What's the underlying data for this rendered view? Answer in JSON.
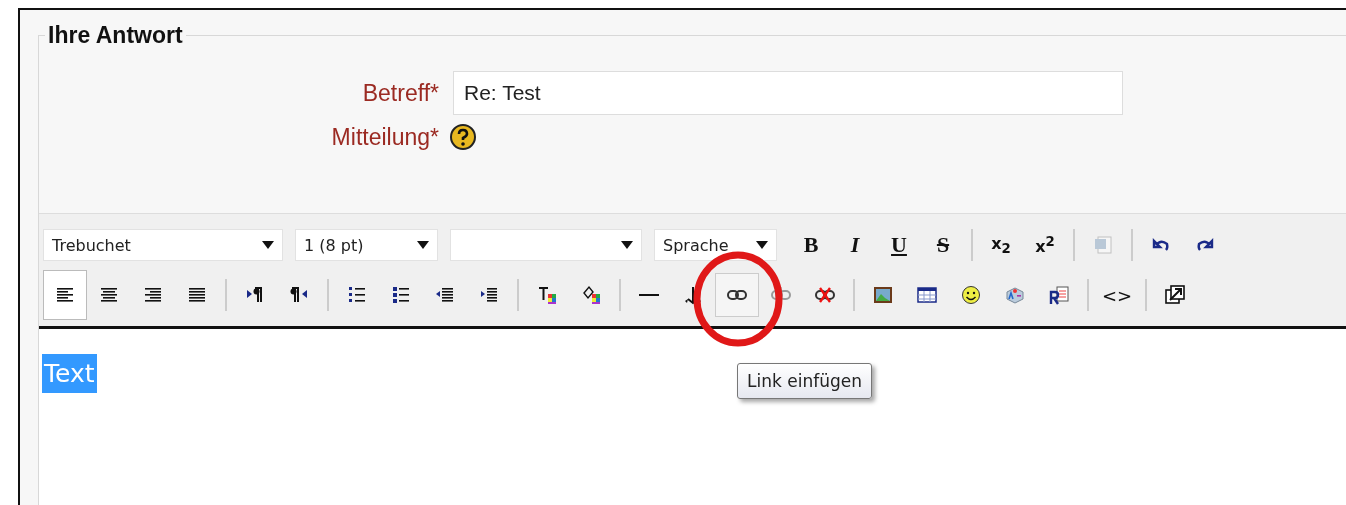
{
  "fieldset": {
    "legend": "Ihre Antwort"
  },
  "fields": [
    {
      "label": "Betreff*",
      "kind": "text",
      "value": "Re: Test"
    },
    {
      "label": "Mitteilung*",
      "kind": "help"
    }
  ],
  "toolbar": {
    "rows": [
      [
        {
          "kind": "select",
          "value": "Trebuchet"
        },
        {
          "kind": "select",
          "value": "1 (8 pt)"
        },
        {
          "kind": "select"
        },
        {
          "kind": "select",
          "value": "Sprache"
        },
        {
          "kind": "glyph",
          "glyph": "B",
          "disabled": false
        },
        {
          "kind": "glyph",
          "glyph": "I",
          "disabled": false
        },
        {
          "kind": "glyph",
          "glyph": "U",
          "disabled": false
        },
        {
          "kind": "glyph",
          "glyph": "S",
          "disabled": false
        },
        {
          "kind": "separator"
        },
        {
          "kind": "glyph",
          "glyph": "x$_{2}$",
          "disabled": false
        },
        {
          "kind": "glyph",
          "glyph": "x$^{2}$",
          "disabled": false
        },
        {
          "kind": "separator"
        },
        {
          "kind": "icon",
          "pressed": false,
          "highlighted": false,
          "disabled": true
        },
        {
          "kind": "separator"
        },
        {
          "kind": "icon",
          "pressed": false,
          "highlighted": false,
          "disabled": false
        },
        {
          "kind": "icon",
          "pressed": false,
          "highlighted": false,
          "disabled": false
        }
      ],
      [
        {
          "kind": "icon",
          "pressed": true,
          "highlighted": false,
          "disabled": false
        },
        {
          "kind": "icon",
          "pressed": false,
          "highlighted": false,
          "disabled": false
        },
        {
          "kind": "icon",
          "pressed": false,
          "highlighted": false,
          "disabled": false
        },
        {
          "kind": "icon",
          "pressed": false,
          "highlighted": false,
          "disabled": false
        },
        {
          "kind": "separator"
        },
        {
          "kind": "icon",
          "pressed": false,
          "highlighted": false,
          "disabled": false
        },
        {
          "kind": "icon",
          "pressed": false,
          "highlighted": false,
          "disabled": false
        },
        {
          "kind": "separator"
        },
        {
          "kind": "icon",
          "pressed": false,
          "highlighted": false,
          "disabled": false
        },
        {
          "kind": "icon",
          "pressed": false,
          "highlighted": false,
          "disabled": false
        },
        {
          "kind": "icon",
          "pressed": false,
          "highlighted": false,
          "disabled": false
        },
        {
          "kind": "icon",
          "pressed": false,
          "highlighted": false,
          "disabled": false
        },
        {
          "kind": "separator"
        },
        {
          "kind": "icon",
          "pressed": false,
          "highlighted": false,
          "disabled": false
        },
        {
          "kind": "icon",
          "pressed": false,
          "highlighted": false,
          "disabled": false
        },
        {
          "kind": "separator"
        },
        {
          "kind": "icon",
          "pressed": false,
          "highlighted": false,
          "disabled": false
        },
        {
          "kind": "icon",
          "pressed": false,
          "highlighted": false,
          "disabled": false
        },
        {
          "kind": "icon",
          "pressed": false,
          "highlighted": true,
          "disabled": false
        },
        {
          "kind": "icon",
          "pressed": false,
          "highlighted": false,
          "disabled": true
        },
        {
          "kind": "icon",
          "pressed": false,
          "highlighted": false,
          "disabled": false
        },
        {
          "kind": "separator"
        },
        {
          "kind": "icon",
          "pressed": false,
          "highlighted": false,
          "disabled": false
        },
        {
          "kind": "icon",
          "pressed": false,
          "highlighted": false,
          "disabled": false
        },
        {
          "kind": "icon",
          "pressed": false,
          "highlighted": false,
          "disabled": false
        },
        {
          "kind": "icon",
          "pressed": false,
          "highlighted": false,
          "disabled": false
        },
        {
          "kind": "icon",
          "pressed": false,
          "highlighted": false,
          "disabled": false
        },
        {
          "kind": "separator"
        },
        {
          "kind": "glyph",
          "glyph": "<>",
          "disabled": false
        },
        {
          "kind": "separator"
        },
        {
          "kind": "icon",
          "pressed": false,
          "highlighted": false,
          "disabled": false
        }
      ]
    ]
  },
  "editor": {
    "text": "Text",
    "selected": true
  },
  "tooltip": {
    "text": "Link einfügen"
  }
}
